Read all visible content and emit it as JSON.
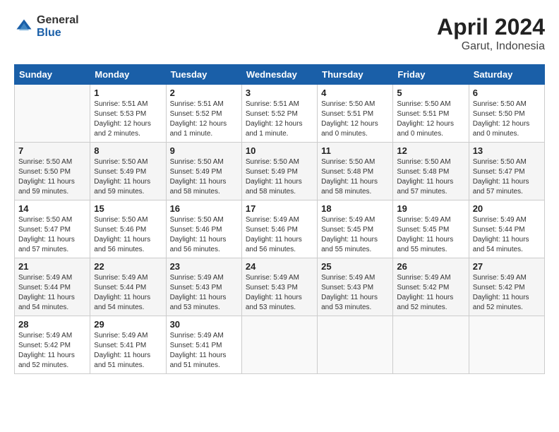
{
  "header": {
    "logo_general": "General",
    "logo_blue": "Blue",
    "title": "April 2024",
    "subtitle": "Garut, Indonesia"
  },
  "days_of_week": [
    "Sunday",
    "Monday",
    "Tuesday",
    "Wednesday",
    "Thursday",
    "Friday",
    "Saturday"
  ],
  "weeks": [
    [
      {
        "day": "",
        "info": ""
      },
      {
        "day": "1",
        "info": "Sunrise: 5:51 AM\nSunset: 5:53 PM\nDaylight: 12 hours\nand 2 minutes."
      },
      {
        "day": "2",
        "info": "Sunrise: 5:51 AM\nSunset: 5:52 PM\nDaylight: 12 hours\nand 1 minute."
      },
      {
        "day": "3",
        "info": "Sunrise: 5:51 AM\nSunset: 5:52 PM\nDaylight: 12 hours\nand 1 minute."
      },
      {
        "day": "4",
        "info": "Sunrise: 5:50 AM\nSunset: 5:51 PM\nDaylight: 12 hours\nand 0 minutes."
      },
      {
        "day": "5",
        "info": "Sunrise: 5:50 AM\nSunset: 5:51 PM\nDaylight: 12 hours\nand 0 minutes."
      },
      {
        "day": "6",
        "info": "Sunrise: 5:50 AM\nSunset: 5:50 PM\nDaylight: 12 hours\nand 0 minutes."
      }
    ],
    [
      {
        "day": "7",
        "info": "Sunrise: 5:50 AM\nSunset: 5:50 PM\nDaylight: 11 hours\nand 59 minutes."
      },
      {
        "day": "8",
        "info": "Sunrise: 5:50 AM\nSunset: 5:49 PM\nDaylight: 11 hours\nand 59 minutes."
      },
      {
        "day": "9",
        "info": "Sunrise: 5:50 AM\nSunset: 5:49 PM\nDaylight: 11 hours\nand 58 minutes."
      },
      {
        "day": "10",
        "info": "Sunrise: 5:50 AM\nSunset: 5:49 PM\nDaylight: 11 hours\nand 58 minutes."
      },
      {
        "day": "11",
        "info": "Sunrise: 5:50 AM\nSunset: 5:48 PM\nDaylight: 11 hours\nand 58 minutes."
      },
      {
        "day": "12",
        "info": "Sunrise: 5:50 AM\nSunset: 5:48 PM\nDaylight: 11 hours\nand 57 minutes."
      },
      {
        "day": "13",
        "info": "Sunrise: 5:50 AM\nSunset: 5:47 PM\nDaylight: 11 hours\nand 57 minutes."
      }
    ],
    [
      {
        "day": "14",
        "info": "Sunrise: 5:50 AM\nSunset: 5:47 PM\nDaylight: 11 hours\nand 57 minutes."
      },
      {
        "day": "15",
        "info": "Sunrise: 5:50 AM\nSunset: 5:46 PM\nDaylight: 11 hours\nand 56 minutes."
      },
      {
        "day": "16",
        "info": "Sunrise: 5:50 AM\nSunset: 5:46 PM\nDaylight: 11 hours\nand 56 minutes."
      },
      {
        "day": "17",
        "info": "Sunrise: 5:49 AM\nSunset: 5:46 PM\nDaylight: 11 hours\nand 56 minutes."
      },
      {
        "day": "18",
        "info": "Sunrise: 5:49 AM\nSunset: 5:45 PM\nDaylight: 11 hours\nand 55 minutes."
      },
      {
        "day": "19",
        "info": "Sunrise: 5:49 AM\nSunset: 5:45 PM\nDaylight: 11 hours\nand 55 minutes."
      },
      {
        "day": "20",
        "info": "Sunrise: 5:49 AM\nSunset: 5:44 PM\nDaylight: 11 hours\nand 54 minutes."
      }
    ],
    [
      {
        "day": "21",
        "info": "Sunrise: 5:49 AM\nSunset: 5:44 PM\nDaylight: 11 hours\nand 54 minutes."
      },
      {
        "day": "22",
        "info": "Sunrise: 5:49 AM\nSunset: 5:44 PM\nDaylight: 11 hours\nand 54 minutes."
      },
      {
        "day": "23",
        "info": "Sunrise: 5:49 AM\nSunset: 5:43 PM\nDaylight: 11 hours\nand 53 minutes."
      },
      {
        "day": "24",
        "info": "Sunrise: 5:49 AM\nSunset: 5:43 PM\nDaylight: 11 hours\nand 53 minutes."
      },
      {
        "day": "25",
        "info": "Sunrise: 5:49 AM\nSunset: 5:43 PM\nDaylight: 11 hours\nand 53 minutes."
      },
      {
        "day": "26",
        "info": "Sunrise: 5:49 AM\nSunset: 5:42 PM\nDaylight: 11 hours\nand 52 minutes."
      },
      {
        "day": "27",
        "info": "Sunrise: 5:49 AM\nSunset: 5:42 PM\nDaylight: 11 hours\nand 52 minutes."
      }
    ],
    [
      {
        "day": "28",
        "info": "Sunrise: 5:49 AM\nSunset: 5:42 PM\nDaylight: 11 hours\nand 52 minutes."
      },
      {
        "day": "29",
        "info": "Sunrise: 5:49 AM\nSunset: 5:41 PM\nDaylight: 11 hours\nand 51 minutes."
      },
      {
        "day": "30",
        "info": "Sunrise: 5:49 AM\nSunset: 5:41 PM\nDaylight: 11 hours\nand 51 minutes."
      },
      {
        "day": "",
        "info": ""
      },
      {
        "day": "",
        "info": ""
      },
      {
        "day": "",
        "info": ""
      },
      {
        "day": "",
        "info": ""
      }
    ]
  ]
}
